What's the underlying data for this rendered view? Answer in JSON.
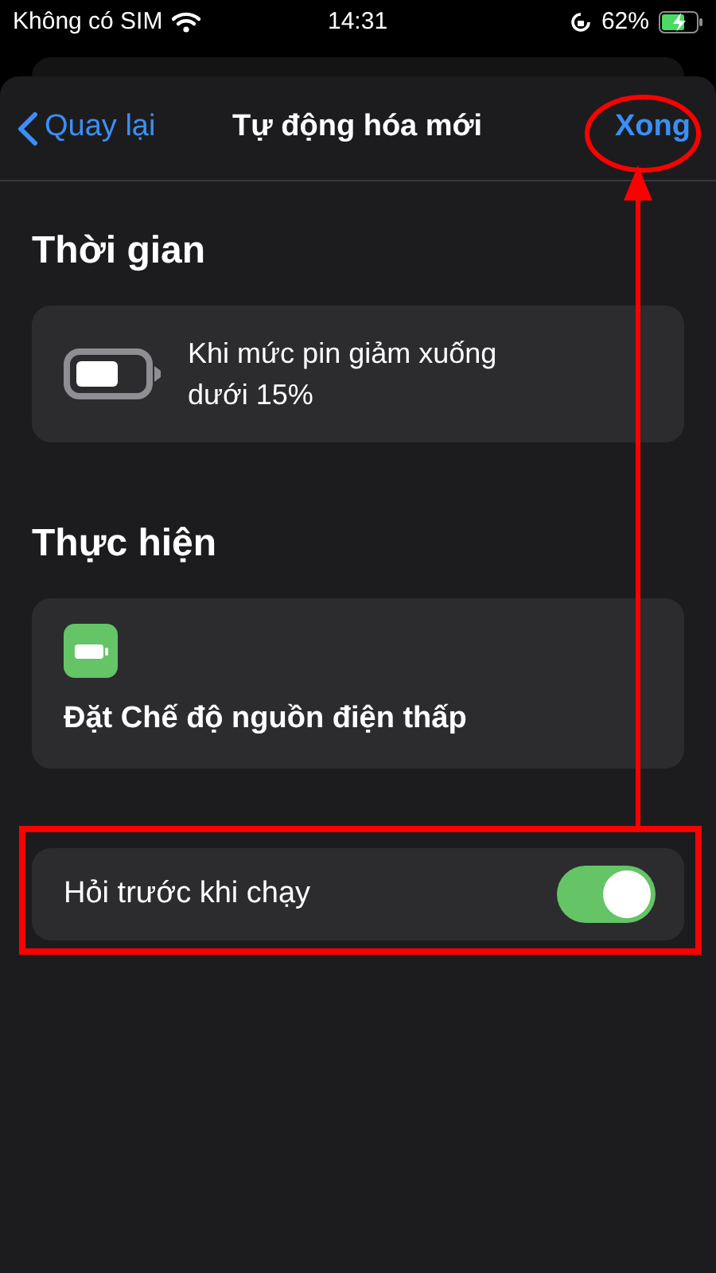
{
  "status_bar": {
    "carrier": "Không có SIM",
    "time": "14:31",
    "battery": "62%"
  },
  "nav": {
    "back": "Quay lại",
    "title": "Tự động hóa mới",
    "done": "Xong"
  },
  "sections": [
    {
      "heading": "Thời gian",
      "card": {
        "kind": "trigger",
        "text": "Khi mức pin giảm xuống dưới 15%"
      }
    },
    {
      "heading": "Thực hiện",
      "card": {
        "kind": "action",
        "text": "Đặt Chế độ nguồn điện thấp"
      }
    }
  ],
  "ask_before_running": {
    "label": "Hỏi trước khi chạy",
    "on": true
  }
}
